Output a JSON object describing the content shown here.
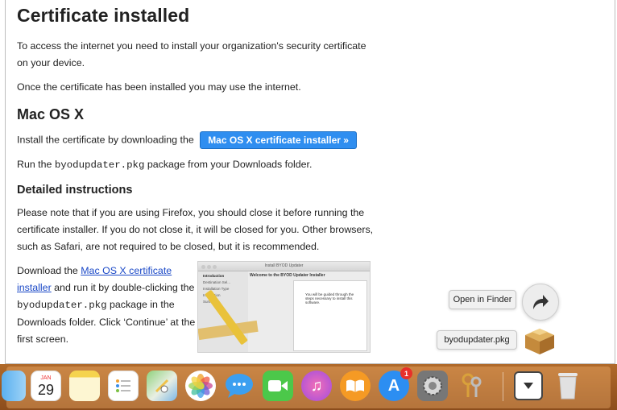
{
  "page": {
    "title": "Certificate installed",
    "intro": "To access the internet you need to install your organization's security certificate on your device.",
    "after": "Once the certificate has been installed you may use the internet.",
    "mac_heading": "Mac OS X",
    "install_text": "Install the certificate by downloading the",
    "install_button": "Mac OS X certificate installer »",
    "run_prefix": "Run the",
    "run_code": "byodupdater.pkg",
    "run_suffix": "package from your Downloads folder.",
    "detailed_heading": "Detailed instructions",
    "firefox_note": "Please note that if you are using Firefox, you should close it before running the certificate installer. If you do not close it, it will be closed for you. Other browsers, such as Safari, are not required to be closed, but it is recommended.",
    "download_prefix": "Download the",
    "download_link": "Mac OS X certificate installer",
    "download_mid": "and run it by double-clicking the",
    "download_code": "byodupdater.pkg",
    "download_suffix": "package in the Downloads folder. Click ‘Continue’ at the first screen."
  },
  "installer_screenshot": {
    "window_title": "Install BYOD Updater",
    "heading": "Welcome to the BYOD Updater Installer",
    "steps": [
      "Introduction",
      "Destination Sel...",
      "Installation Type",
      "Installation",
      "Summary"
    ],
    "body": "You will be guided through the steps necessary to install this software."
  },
  "download_popup": {
    "open_in_finder": "Open in Finder",
    "file_name": "byodupdater.pkg"
  },
  "dock": {
    "calendar_month": "JAN",
    "calendar_day": "29",
    "appstore_badge": "1",
    "icons": [
      "finder-icon",
      "calendar-icon",
      "notes-icon",
      "reminders-icon",
      "maps-icon",
      "photos-icon",
      "messages-icon",
      "facetime-icon",
      "itunes-icon",
      "ibooks-icon",
      "app-store-icon",
      "system-preferences-icon",
      "keychain-access-icon",
      "downloads-stack-icon",
      "trash-icon"
    ]
  }
}
